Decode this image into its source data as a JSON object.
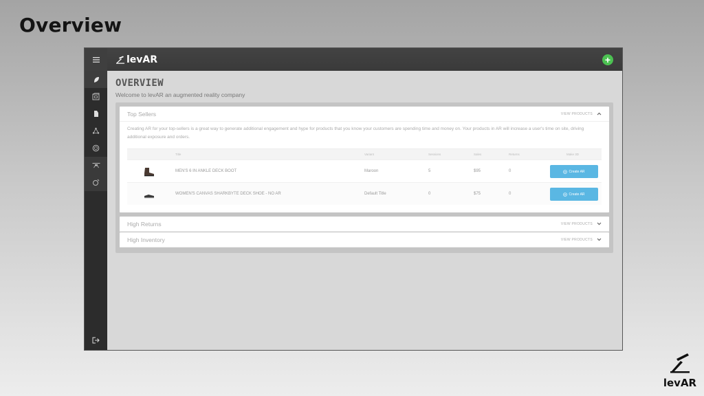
{
  "slide": {
    "title": "Overview"
  },
  "app": {
    "brand": "levAR",
    "add_label": "+",
    "accent_color": "#5ab7e3",
    "add_color": "#4cc152"
  },
  "sidebar": {
    "menu_icon": "hamburger-icon",
    "items": [
      {
        "name": "home",
        "icon": "leaf-icon"
      },
      {
        "name": "catalog",
        "icon": "cube-icon"
      },
      {
        "name": "products",
        "icon": "tag-icon"
      },
      {
        "name": "models",
        "icon": "network-icon"
      },
      {
        "name": "analytics",
        "icon": "globe-icon"
      },
      {
        "name": "integrations",
        "icon": "drone-icon"
      },
      {
        "name": "settings",
        "icon": "gear-icon"
      }
    ],
    "logout_icon": "logout-icon"
  },
  "page": {
    "title": "OVERVIEW",
    "subtitle": "Welcome to levAR an augmented reality company"
  },
  "sections": {
    "top_sellers": {
      "title": "Top Sellers",
      "view_label": "VIEW PRODUCTS",
      "description": "Creating AR for your top-sellers is a great way to generate additional engagement and hype for products that you know your customers are spending time and money on. Your products in AR will increase a user's time on site, driving additional exposure and orders.",
      "columns": {
        "title": "Title",
        "variant": "Variant",
        "sessions": "Sessions",
        "sales": "Sales",
        "returns": "Returns",
        "make_3d": "Make 3D"
      },
      "rows": [
        {
          "title": "MEN'S 6 IN ANKLE DECK BOOT",
          "variant": "Maroon",
          "sessions": "5",
          "sales": "$95",
          "returns": "0",
          "action": "Create AR"
        },
        {
          "title": "WOMEN'S CANVAS SHARKBYTE DECK SHOE - NO AR",
          "variant": "Default Title",
          "sessions": "0",
          "sales": "$75",
          "returns": "0",
          "action": "Create AR"
        }
      ]
    },
    "high_returns": {
      "title": "High Returns",
      "view_label": "VIEW PRODUCTS"
    },
    "high_inventory": {
      "title": "High Inventory",
      "view_label": "VIEW PRODUCTS"
    }
  },
  "footer": {
    "brand": "levAR"
  }
}
